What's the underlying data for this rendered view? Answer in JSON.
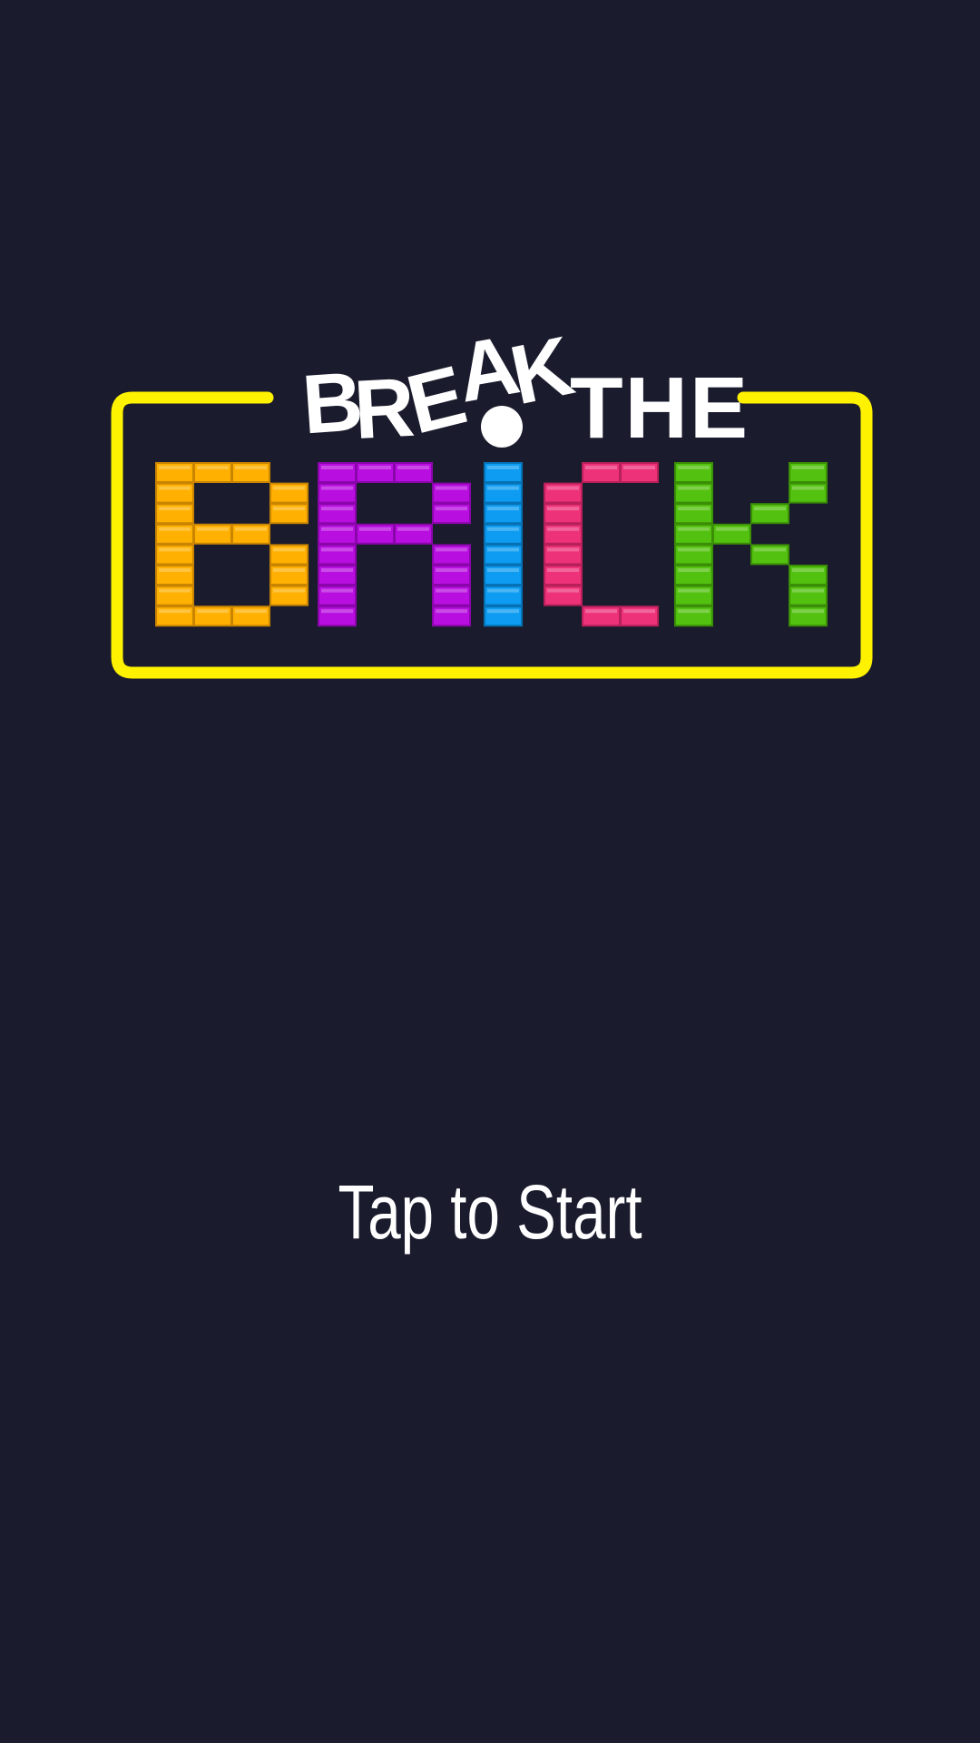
{
  "screen": {
    "background_color": "#1a1c2d",
    "start_prompt": "Tap to Start"
  },
  "logo": {
    "line1": {
      "break_letters": [
        "B",
        "R",
        "E",
        "A",
        "K"
      ],
      "the_word": "THE",
      "exclamation": "!"
    },
    "line2_letters": [
      {
        "letter": "B",
        "color": "#ffb000",
        "edge": "#c98500"
      },
      {
        "letter": "R",
        "color": "#b90ee0",
        "edge": "#8a06ab"
      },
      {
        "letter": "I",
        "color": "#0d9cf2",
        "edge": "#0672b5"
      },
      {
        "letter": "C",
        "color": "#ee3279",
        "edge": "#b8205a"
      },
      {
        "letter": "K",
        "color": "#53c10f",
        "edge": "#3b8e07"
      }
    ],
    "frame_color": "#fff200",
    "text_color": "#ffffff"
  }
}
